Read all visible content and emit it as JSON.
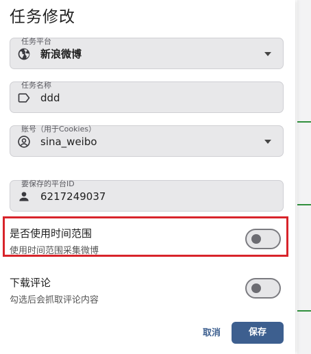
{
  "dialog": {
    "title": "任务修改"
  },
  "fields": {
    "platform": {
      "label": "任务平台",
      "value": "新浪微博",
      "icon": "globe-icon"
    },
    "task_name": {
      "label": "任务名称",
      "value": "ddd",
      "icon": "tag-icon"
    },
    "account": {
      "label": "账号（用于Cookies）",
      "value": "sina_weibo",
      "icon": "account-circle-icon"
    },
    "platform_id": {
      "label": "要保存的平台ID",
      "value": "6217249037",
      "icon": "person-icon"
    }
  },
  "switches": {
    "time_range": {
      "title": "是否使用时间范围",
      "subtitle": "使用时间范围采集微博",
      "on": false
    },
    "comments": {
      "title": "下载评论",
      "subtitle": "勾选后会抓取评论内容",
      "on": false
    }
  },
  "actions": {
    "cancel_label": "取消",
    "save_label": "保存"
  },
  "colors": {
    "primary": "#3d5f8f",
    "highlight": "#d8232a",
    "field_bg": "#e8e8ea"
  }
}
